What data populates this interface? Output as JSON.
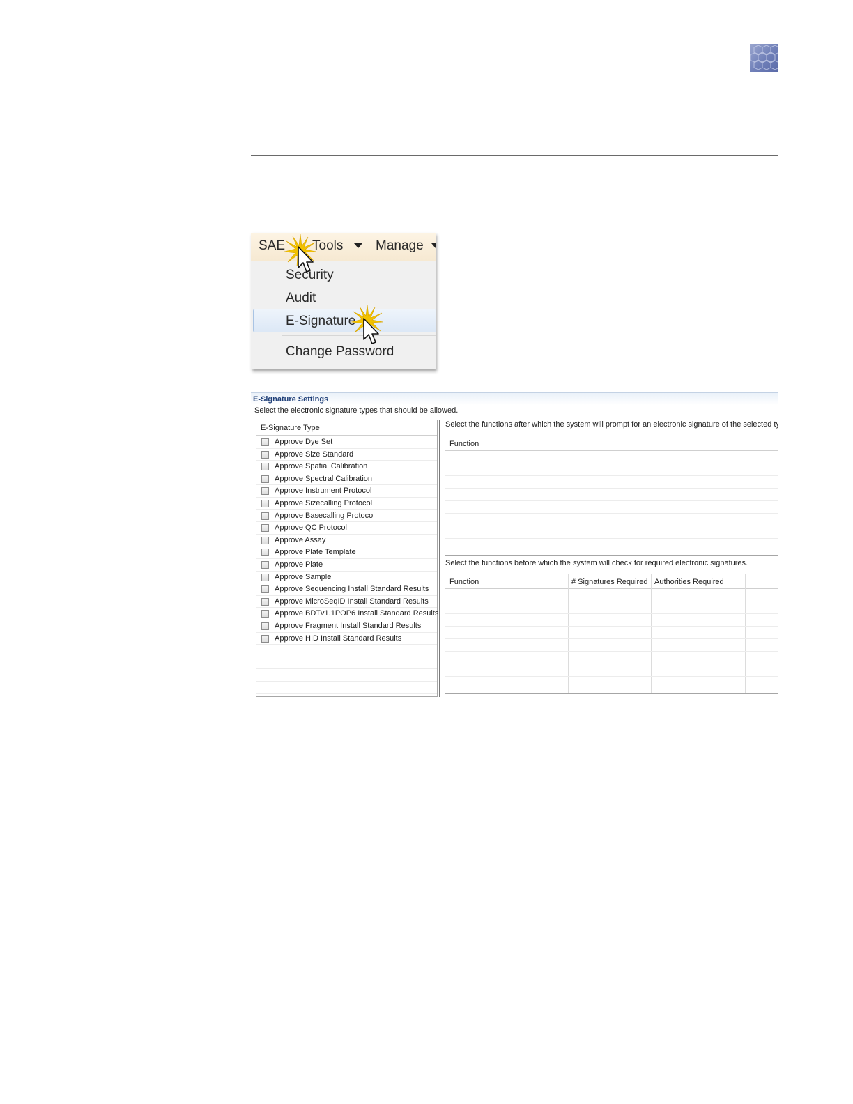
{
  "menu": {
    "top_items": [
      "SAE",
      "Tools",
      "Manage"
    ],
    "dropdown_items": [
      "Security",
      "Audit",
      "E-Signature",
      "Change Password"
    ],
    "highlighted_item": "E-Signature"
  },
  "esignature_settings": {
    "title": "E-Signature Settings",
    "subtitle": "Select the electronic signature types that should be allowed.",
    "type_column_header": "E-Signature Type",
    "types": [
      "Approve Dye Set",
      "Approve Size Standard",
      "Approve Spatial Calibration",
      "Approve Spectral Calibration",
      "Approve Instrument Protocol",
      "Approve Sizecalling Protocol",
      "Approve Basecalling Protocol",
      "Approve QC Protocol",
      "Approve Assay",
      "Approve Plate Template",
      "Approve Plate",
      "Approve Sample",
      "Approve Sequencing Install Standard Results",
      "Approve MicroSeqID Install Standard Results",
      "Approve BDTv1.1POP6 Install Standard Results",
      "Approve Fragment Install Standard Results",
      "Approve HID Install Standard Results"
    ],
    "prompt_caption": "Select the functions after which the system will prompt for an electronic signature of the selected type.",
    "prompt_table_headers": [
      "Function"
    ],
    "check_caption": "Select the functions before which the system will check for required electronic signatures.",
    "check_table_headers": [
      "Function",
      "# Signatures Required",
      "Authorities Required"
    ]
  }
}
